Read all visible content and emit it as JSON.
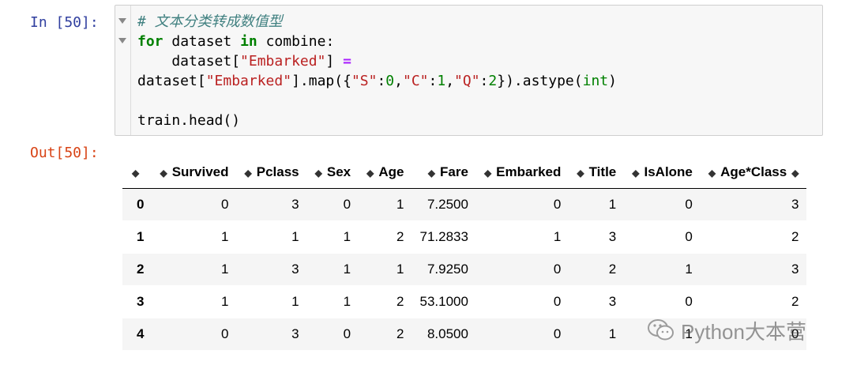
{
  "input_prompt": "In [50]:",
  "output_prompt": "Out[50]:",
  "code": {
    "comment": "# 文本分类转成数值型",
    "l2_kw1": "for",
    "l2_var": " dataset ",
    "l2_kw2": "in",
    "l2_rest": " combine:",
    "l3_indent": "    dataset[",
    "l3_str": "\"Embarked\"",
    "l3_close": "] ",
    "l3_op": "=",
    "l4_a": "dataset[",
    "l4_str1": "\"Embarked\"",
    "l4_b": "].map({",
    "l4_s": "\"S\"",
    "l4_c1": ":",
    "l4_n0": "0",
    "l4_c2": ",",
    "l4_c": "\"C\"",
    "l4_c3": ":",
    "l4_n1": "1",
    "l4_c4": ",",
    "l4_q": "\"Q\"",
    "l4_c5": ":",
    "l4_n2": "2",
    "l4_d": "}).astype(",
    "l4_int": "int",
    "l4_e": ")",
    "l6": "train.head()"
  },
  "table": {
    "sort_glyph": "◆",
    "columns": [
      "Survived",
      "Pclass",
      "Sex",
      "Age",
      "Fare",
      "Embarked",
      "Title",
      "IsAlone",
      "Age*Class"
    ],
    "rows": [
      {
        "index": "0",
        "cells": [
          "0",
          "3",
          "0",
          "1",
          "7.2500",
          "0",
          "1",
          "0",
          "3"
        ]
      },
      {
        "index": "1",
        "cells": [
          "1",
          "1",
          "1",
          "2",
          "71.2833",
          "1",
          "3",
          "0",
          "2"
        ]
      },
      {
        "index": "2",
        "cells": [
          "1",
          "3",
          "1",
          "1",
          "7.9250",
          "0",
          "2",
          "1",
          "3"
        ]
      },
      {
        "index": "3",
        "cells": [
          "1",
          "1",
          "1",
          "2",
          "53.1000",
          "0",
          "3",
          "0",
          "2"
        ]
      },
      {
        "index": "4",
        "cells": [
          "0",
          "3",
          "0",
          "2",
          "8.0500",
          "0",
          "1",
          "1",
          "0"
        ]
      }
    ]
  },
  "watermark": {
    "text": "Python大本营",
    "icon": "wechat-icon"
  }
}
